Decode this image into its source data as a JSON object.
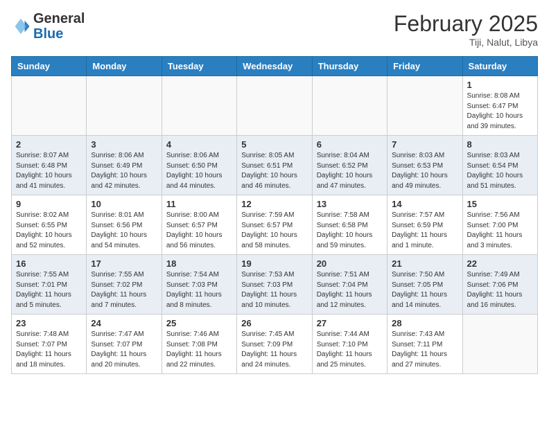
{
  "header": {
    "logo_general": "General",
    "logo_blue": "Blue",
    "month_title": "February 2025",
    "location": "Tiji, Nalut, Libya"
  },
  "days_of_week": [
    "Sunday",
    "Monday",
    "Tuesday",
    "Wednesday",
    "Thursday",
    "Friday",
    "Saturday"
  ],
  "weeks": [
    [
      {
        "day": "",
        "info": ""
      },
      {
        "day": "",
        "info": ""
      },
      {
        "day": "",
        "info": ""
      },
      {
        "day": "",
        "info": ""
      },
      {
        "day": "",
        "info": ""
      },
      {
        "day": "",
        "info": ""
      },
      {
        "day": "1",
        "info": "Sunrise: 8:08 AM\nSunset: 6:47 PM\nDaylight: 10 hours\nand 39 minutes."
      }
    ],
    [
      {
        "day": "2",
        "info": "Sunrise: 8:07 AM\nSunset: 6:48 PM\nDaylight: 10 hours\nand 41 minutes."
      },
      {
        "day": "3",
        "info": "Sunrise: 8:06 AM\nSunset: 6:49 PM\nDaylight: 10 hours\nand 42 minutes."
      },
      {
        "day": "4",
        "info": "Sunrise: 8:06 AM\nSunset: 6:50 PM\nDaylight: 10 hours\nand 44 minutes."
      },
      {
        "day": "5",
        "info": "Sunrise: 8:05 AM\nSunset: 6:51 PM\nDaylight: 10 hours\nand 46 minutes."
      },
      {
        "day": "6",
        "info": "Sunrise: 8:04 AM\nSunset: 6:52 PM\nDaylight: 10 hours\nand 47 minutes."
      },
      {
        "day": "7",
        "info": "Sunrise: 8:03 AM\nSunset: 6:53 PM\nDaylight: 10 hours\nand 49 minutes."
      },
      {
        "day": "8",
        "info": "Sunrise: 8:03 AM\nSunset: 6:54 PM\nDaylight: 10 hours\nand 51 minutes."
      }
    ],
    [
      {
        "day": "9",
        "info": "Sunrise: 8:02 AM\nSunset: 6:55 PM\nDaylight: 10 hours\nand 52 minutes."
      },
      {
        "day": "10",
        "info": "Sunrise: 8:01 AM\nSunset: 6:56 PM\nDaylight: 10 hours\nand 54 minutes."
      },
      {
        "day": "11",
        "info": "Sunrise: 8:00 AM\nSunset: 6:57 PM\nDaylight: 10 hours\nand 56 minutes."
      },
      {
        "day": "12",
        "info": "Sunrise: 7:59 AM\nSunset: 6:57 PM\nDaylight: 10 hours\nand 58 minutes."
      },
      {
        "day": "13",
        "info": "Sunrise: 7:58 AM\nSunset: 6:58 PM\nDaylight: 10 hours\nand 59 minutes."
      },
      {
        "day": "14",
        "info": "Sunrise: 7:57 AM\nSunset: 6:59 PM\nDaylight: 11 hours\nand 1 minute."
      },
      {
        "day": "15",
        "info": "Sunrise: 7:56 AM\nSunset: 7:00 PM\nDaylight: 11 hours\nand 3 minutes."
      }
    ],
    [
      {
        "day": "16",
        "info": "Sunrise: 7:55 AM\nSunset: 7:01 PM\nDaylight: 11 hours\nand 5 minutes."
      },
      {
        "day": "17",
        "info": "Sunrise: 7:55 AM\nSunset: 7:02 PM\nDaylight: 11 hours\nand 7 minutes."
      },
      {
        "day": "18",
        "info": "Sunrise: 7:54 AM\nSunset: 7:03 PM\nDaylight: 11 hours\nand 8 minutes."
      },
      {
        "day": "19",
        "info": "Sunrise: 7:53 AM\nSunset: 7:03 PM\nDaylight: 11 hours\nand 10 minutes."
      },
      {
        "day": "20",
        "info": "Sunrise: 7:51 AM\nSunset: 7:04 PM\nDaylight: 11 hours\nand 12 minutes."
      },
      {
        "day": "21",
        "info": "Sunrise: 7:50 AM\nSunset: 7:05 PM\nDaylight: 11 hours\nand 14 minutes."
      },
      {
        "day": "22",
        "info": "Sunrise: 7:49 AM\nSunset: 7:06 PM\nDaylight: 11 hours\nand 16 minutes."
      }
    ],
    [
      {
        "day": "23",
        "info": "Sunrise: 7:48 AM\nSunset: 7:07 PM\nDaylight: 11 hours\nand 18 minutes."
      },
      {
        "day": "24",
        "info": "Sunrise: 7:47 AM\nSunset: 7:07 PM\nDaylight: 11 hours\nand 20 minutes."
      },
      {
        "day": "25",
        "info": "Sunrise: 7:46 AM\nSunset: 7:08 PM\nDaylight: 11 hours\nand 22 minutes."
      },
      {
        "day": "26",
        "info": "Sunrise: 7:45 AM\nSunset: 7:09 PM\nDaylight: 11 hours\nand 24 minutes."
      },
      {
        "day": "27",
        "info": "Sunrise: 7:44 AM\nSunset: 7:10 PM\nDaylight: 11 hours\nand 25 minutes."
      },
      {
        "day": "28",
        "info": "Sunrise: 7:43 AM\nSunset: 7:11 PM\nDaylight: 11 hours\nand 27 minutes."
      },
      {
        "day": "",
        "info": ""
      }
    ]
  ]
}
